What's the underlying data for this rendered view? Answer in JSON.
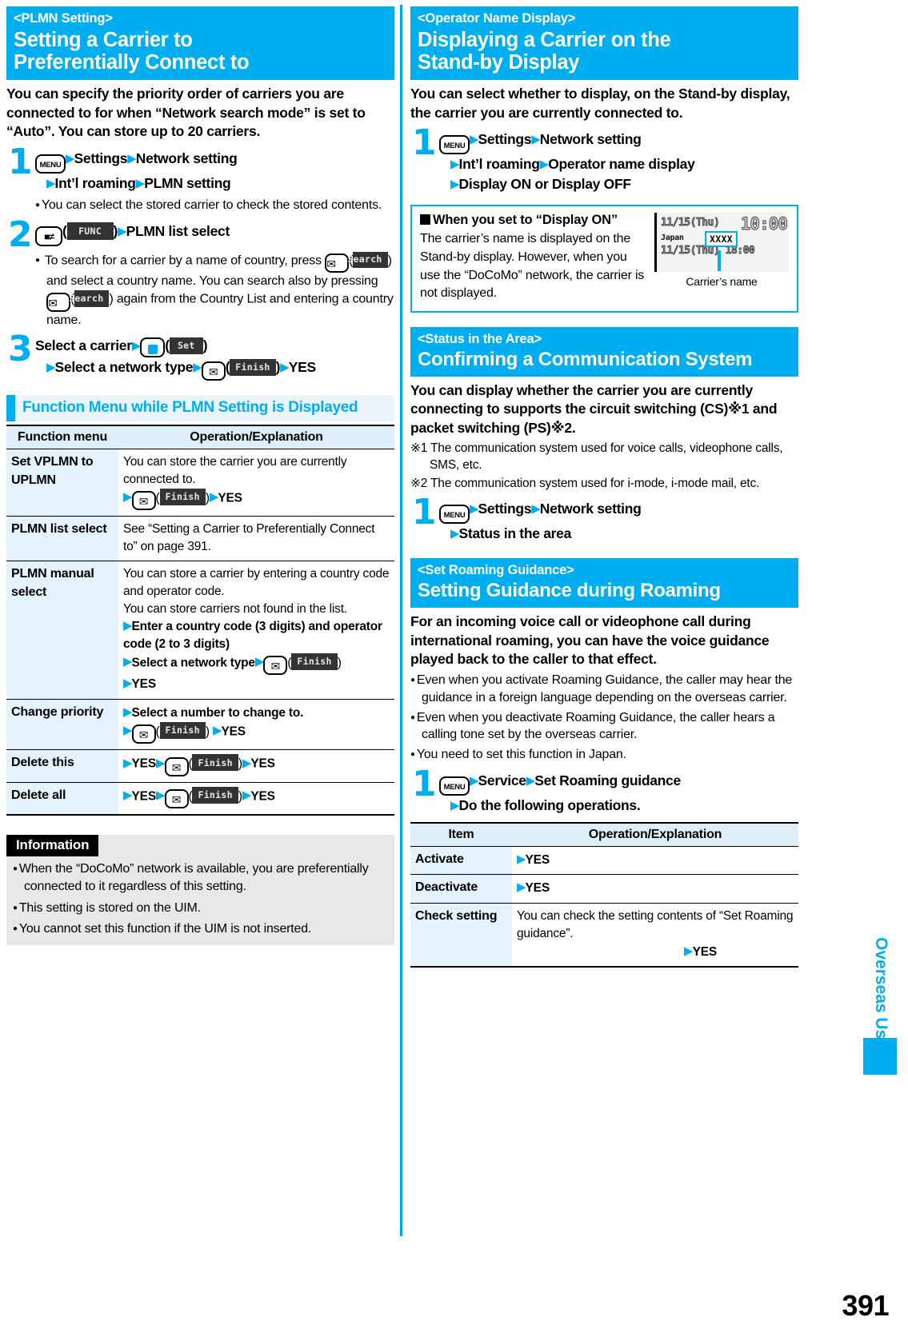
{
  "page": {
    "number": "391",
    "side_tab": "Overseas Use"
  },
  "left_column": {
    "section": {
      "tag": "<PLMN Setting>",
      "title_line1": "Setting a Carrier to",
      "title_line2": "Preferentially Connect to"
    },
    "lead": "You can specify the priority order of carriers you are connected to for when “Network search mode” is set to “Auto”. You can store up to 20 carriers.",
    "steps": [
      {
        "num": "1",
        "line1_key": "MENU",
        "line1_a": "Settings",
        "line1_b": "Network setting",
        "line2_a": "Int’l roaming",
        "line2_b": "PLMN setting",
        "bullet": "You can select the stored carrier to check the stored contents."
      },
      {
        "num": "2",
        "softkey": "FUNC",
        "line1_a": "PLMN list select",
        "bullet_part1": "To search for a carrier by a name of country, press",
        "bullet_softkey1": "Search",
        "bullet_part2": ") and select a country name. You can search also by pressing",
        "bullet_softkey2": "Search",
        "bullet_part3": ") again from the Country List and entering a country name."
      },
      {
        "num": "3",
        "line1_a": "Select a carrier",
        "softkey_set": "Set",
        "line2_a": "Select a network type",
        "softkey_finish": "Finish",
        "line2_b": "YES"
      }
    ],
    "subhead": "Function Menu while PLMN Setting is Displayed",
    "table": {
      "headers": [
        "Function menu",
        "Operation/Explanation"
      ],
      "rows": [
        {
          "item": "Set VPLMN to UPLMN",
          "lines": [
            {
              "type": "plain",
              "text": "You can store the carrier you are currently connected to."
            },
            {
              "type": "keyline",
              "prefix": "",
              "softkey": "Finish",
              "suffix": "YES"
            }
          ]
        },
        {
          "item": "PLMN list select",
          "lines": [
            {
              "type": "plain",
              "text": "See “Setting a Carrier to Preferentially Connect to” on page 391."
            }
          ]
        },
        {
          "item": "PLMN manual select",
          "lines": [
            {
              "type": "plain",
              "text": "You can store a carrier by entering a country code and operator code."
            },
            {
              "type": "plain",
              "text": "You can store carriers not found in the list."
            },
            {
              "type": "bold",
              "text": "Enter a country code (3 digits) and operator code (2 to 3 digits)"
            },
            {
              "type": "keyline",
              "prefix": "Select a network type",
              "softkey": "Finish",
              "suffix": ""
            },
            {
              "type": "bold",
              "text": "YES"
            }
          ]
        },
        {
          "item": "Change priority",
          "lines": [
            {
              "type": "bold",
              "text": "Select a number to change to."
            },
            {
              "type": "keyline",
              "prefix": "",
              "softkey": "Finish",
              "suffix": "YES"
            }
          ]
        },
        {
          "item": "Delete this",
          "lines": [
            {
              "type": "yesline",
              "first": "YES",
              "softkey": "Finish",
              "last": "YES"
            }
          ]
        },
        {
          "item": "Delete all",
          "lines": [
            {
              "type": "yesline",
              "first": "YES",
              "softkey": "Finish",
              "last": "YES"
            }
          ]
        }
      ]
    },
    "information": {
      "label": "Information",
      "items": [
        "When the “DoCoMo” network is available, you are preferentially connected to it regardless of this setting.",
        "This setting is stored on the UIM.",
        "You cannot set this function if the UIM is not inserted."
      ]
    }
  },
  "right_column": {
    "section_operator": {
      "tag": "<Operator Name Display>",
      "title_line1": "Displaying a Carrier on the",
      "title_line2": "Stand-by Display",
      "lead": "You can select whether to display, on the Stand-by display, the carrier you are currently connected to.",
      "step": {
        "num": "1",
        "line1_key": "MENU",
        "line1_a": "Settings",
        "line1_b": "Network setting",
        "line2_a": "Int’l roaming",
        "line2_b": "Operator name display",
        "line3_a": "Display ON or Display OFF"
      },
      "callout": {
        "heading": "When you set to “Display ON”",
        "body": "The carrier’s name is displayed on the Stand-by display. However, when you use the “DoCoMo” network, the carrier is not displayed.",
        "phone": {
          "line1": "11/15(Thu)",
          "time": "10:00",
          "line2": "Japan",
          "badge": "XXXX",
          "line3": "11/15(Thu) 18:00"
        },
        "caption": "Carrier’s name"
      }
    },
    "section_status": {
      "tag": "<Status in the Area>",
      "title": "Confirming a Communication System",
      "lead": "You can display whether the carrier you are currently connecting to supports the circuit switching (CS)※1 and packet switching (PS)※2.",
      "notes": [
        "※1 The communication system used for voice calls, videophone calls, SMS, etc.",
        "※2 The communication system used for i-mode, i-mode mail, etc."
      ],
      "step": {
        "num": "1",
        "line1_key": "MENU",
        "line1_a": "Settings",
        "line1_b": "Network setting",
        "line2_a": "Status in the area"
      }
    },
    "section_roaming": {
      "tag": "<Set Roaming Guidance>",
      "title": "Setting Guidance during Roaming",
      "lead": "For an incoming voice call or videophone call during international roaming, you can have the voice guidance played back to the caller to that effect.",
      "bullets": [
        "Even when you activate Roaming Guidance, the caller may hear the guidance in a foreign language depending on the overseas carrier.",
        "Even when you deactivate Roaming Guidance, the caller hears a calling tone set by the overseas carrier.",
        "You need to set this function in Japan."
      ],
      "step": {
        "num": "1",
        "line1_key": "MENU",
        "line1_a": "Service",
        "line1_b": "Set Roaming guidance",
        "line2_a": "Do the following operations."
      },
      "table": {
        "headers": [
          "Item",
          "Operation/Explanation"
        ],
        "rows": [
          {
            "item": "Activate",
            "op_arrow": "YES",
            "op_text": ""
          },
          {
            "item": "Deactivate",
            "op_arrow": "YES",
            "op_text": ""
          },
          {
            "item": "Check setting",
            "op_text": "You can check the setting contents of “Set Roaming guidance”.",
            "op_arrow_after": "YES"
          }
        ]
      }
    }
  },
  "colors": {
    "accent": "#00AEEF",
    "table_head": "#ddeef8",
    "table_cell": "#e3f2fb",
    "info_bg": "#e8e8e8"
  }
}
